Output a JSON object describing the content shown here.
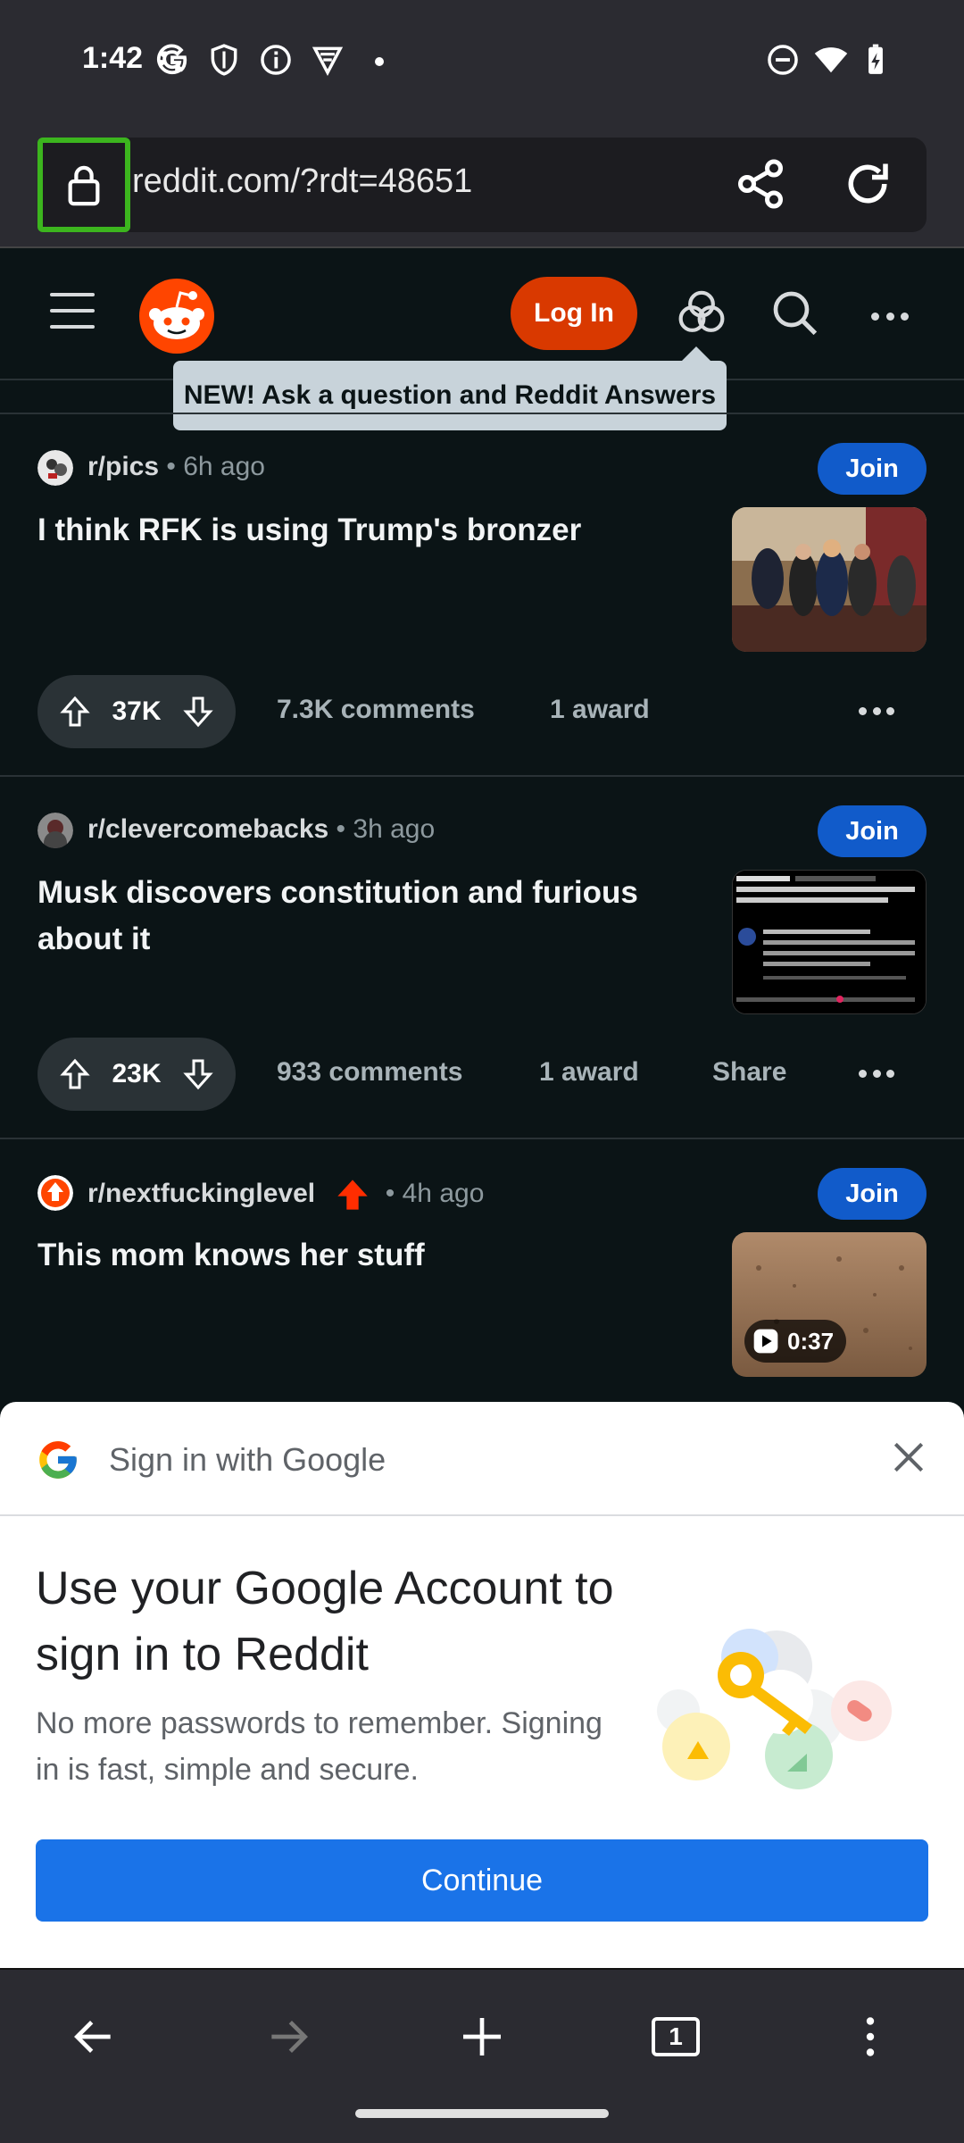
{
  "status_bar": {
    "time": "1:42"
  },
  "browser": {
    "url": "reddit.com/?rdt=48651"
  },
  "reddit_header": {
    "login_label": "Log In",
    "tooltip": "NEW! Ask a question and Reddit Answers"
  },
  "posts": [
    {
      "subreddit": "r/pics",
      "time": "• 6h ago",
      "join_label": "Join",
      "title": "I think RFK is using Trump's bronzer",
      "votes": "37K",
      "comments": "7.3K comments",
      "awards": "1 award",
      "share": ""
    },
    {
      "subreddit": "r/clevercomebacks",
      "time": "• 3h ago",
      "join_label": "Join",
      "title": "Musk discovers constitution and furious about it",
      "votes": "23K",
      "comments": "933 comments",
      "awards": "1 award",
      "share": "Share"
    },
    {
      "subreddit": "r/nextfuckinglevel",
      "time": "• 4h ago",
      "join_label": "Join",
      "title": "This mom knows her stuff",
      "video_duration": "0:37"
    }
  ],
  "sign_in_sheet": {
    "header": "Sign in with Google",
    "title": "Use your Google Account to sign in to Reddit",
    "subtitle": "No more passwords to remember. Signing in is fast, simple and secure.",
    "continue_label": "Continue"
  },
  "nav": {
    "tab_count": "1"
  },
  "colors": {
    "reddit_orange": "#ff4500",
    "join_blue": "#115bca",
    "google_blue": "#1a73e8",
    "highlight_green": "#3cb51e"
  }
}
